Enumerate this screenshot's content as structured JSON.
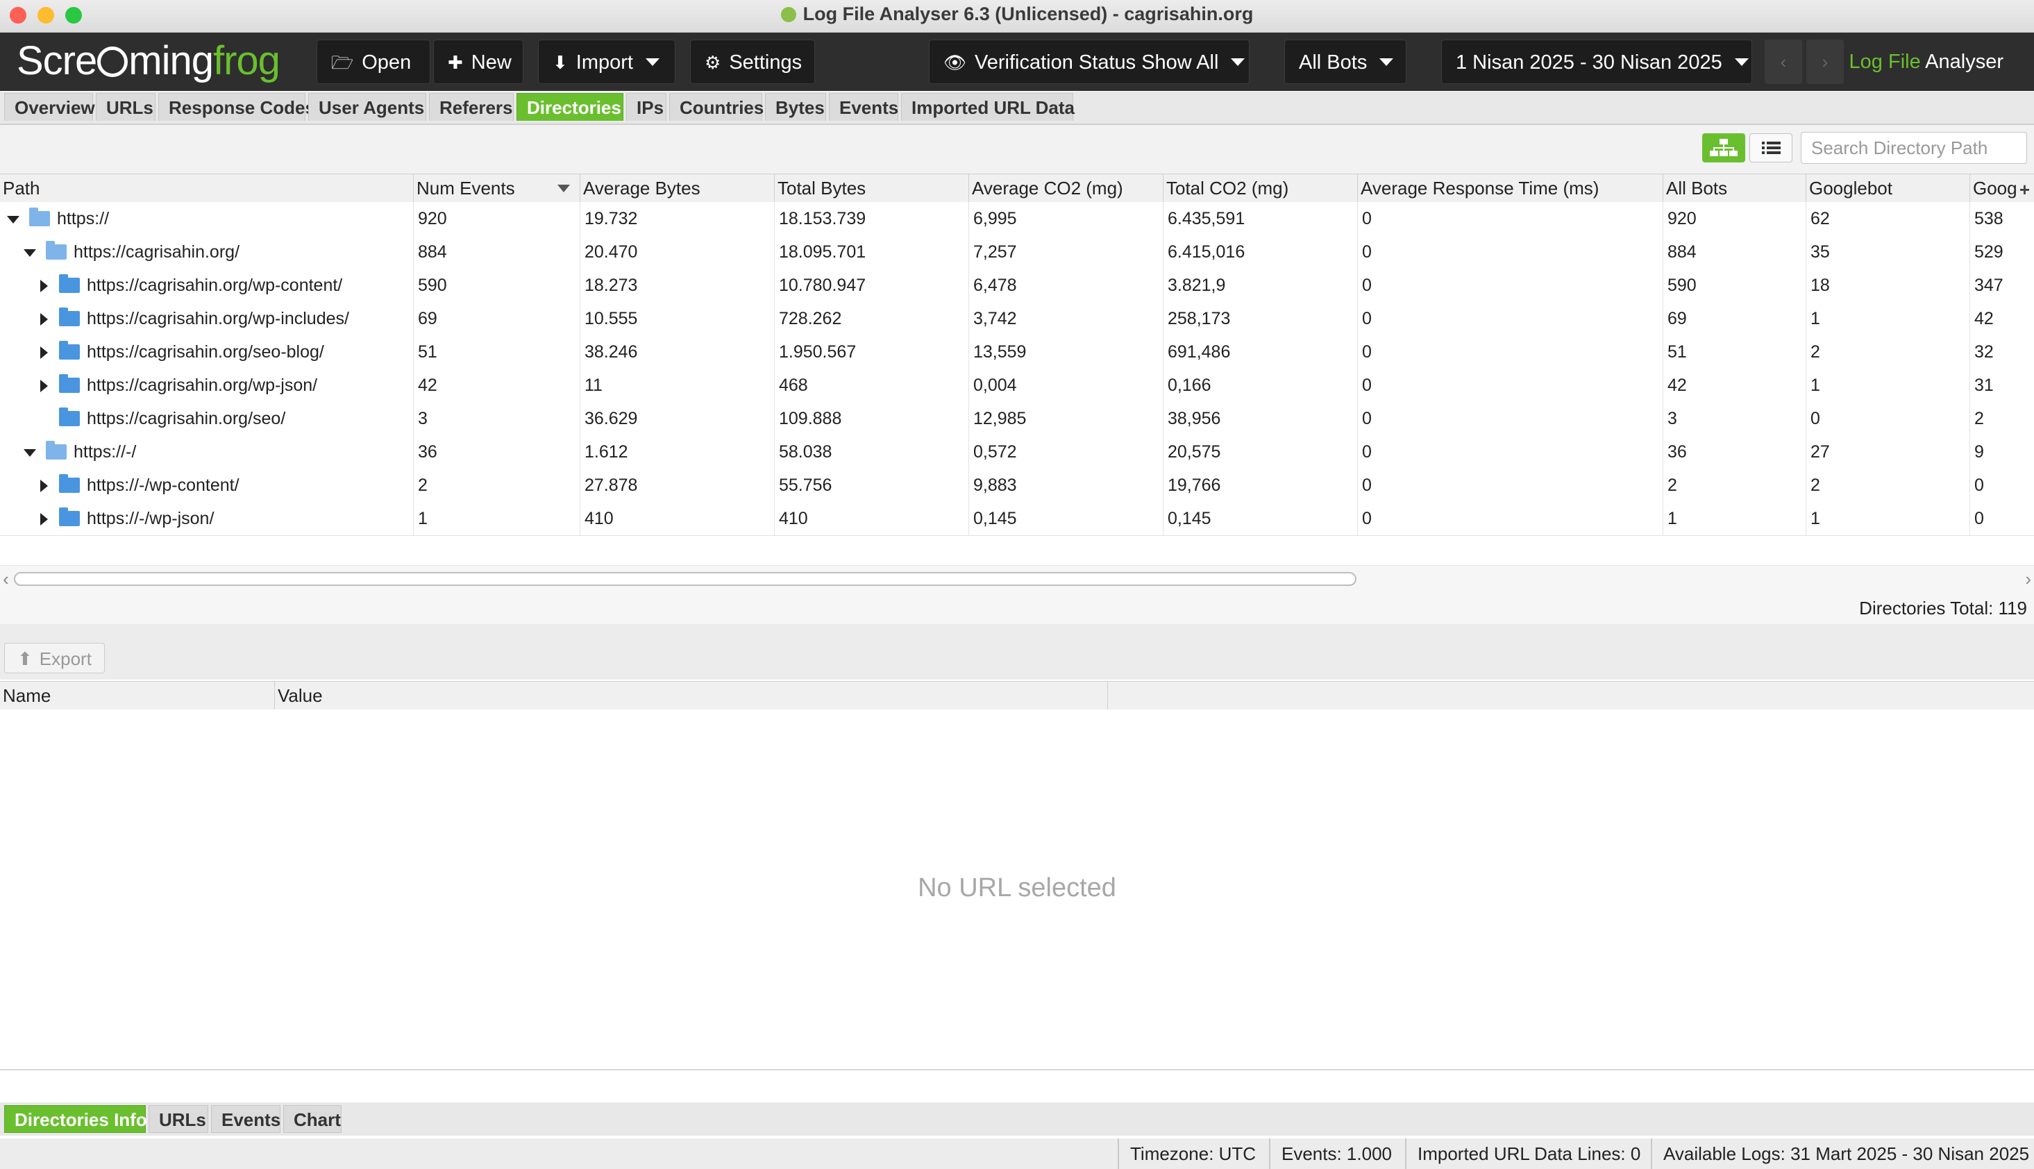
{
  "window": {
    "title": "Log File Analyser 6.3 (Unlicensed) - cagrisahin.org"
  },
  "toolbar": {
    "logo": {
      "part1": "Scre",
      "part2": "ming",
      "part3": "frog"
    },
    "open": "Open",
    "new": "New",
    "import": "Import",
    "settings": "Settings",
    "verification": "Verification Status Show All",
    "bots": "All Bots",
    "date_range": "1 Nisan 2025 - 30 Nisan 2025",
    "prev": "‹",
    "next": "›",
    "brand_green": "Log File",
    "brand_white": " Analyser"
  },
  "tabs": [
    "Overview",
    "URLs",
    "Response Codes",
    "User Agents",
    "Referers",
    "Directories",
    "IPs",
    "Countries",
    "Bytes",
    "Events",
    "Imported URL Data"
  ],
  "active_tab": "Directories",
  "search": {
    "placeholder": "Search Directory Path"
  },
  "grid": {
    "columns": [
      "Path",
      "Num Events",
      "Average Bytes",
      "Total Bytes",
      "Average CO2 (mg)",
      "Total CO2 (mg)",
      "Average Response Time (ms)",
      "All Bots",
      "Googlebot",
      "Goog"
    ],
    "rows": [
      [
        "https://",
        "920",
        "19.732",
        "18.153.739",
        "6,995",
        "6.435,591",
        "0",
        "920",
        "62",
        "538"
      ],
      [
        "https://cagrisahin.org/",
        "884",
        "20.470",
        "18.095.701",
        "7,257",
        "6.415,016",
        "0",
        "884",
        "35",
        "529"
      ],
      [
        "https://cagrisahin.org/wp-content/",
        "590",
        "18.273",
        "10.780.947",
        "6,478",
        "3.821,9",
        "0",
        "590",
        "18",
        "347"
      ],
      [
        "https://cagrisahin.org/wp-includes/",
        "69",
        "10.555",
        "728.262",
        "3,742",
        "258,173",
        "0",
        "69",
        "1",
        "42"
      ],
      [
        "https://cagrisahin.org/seo-blog/",
        "51",
        "38.246",
        "1.950.567",
        "13,559",
        "691,486",
        "0",
        "51",
        "2",
        "32"
      ],
      [
        "https://cagrisahin.org/wp-json/",
        "42",
        "11",
        "468",
        "0,004",
        "0,166",
        "0",
        "42",
        "1",
        "31"
      ],
      [
        "https://cagrisahin.org/seo/",
        "3",
        "36.629",
        "109.888",
        "12,985",
        "38,956",
        "0",
        "3",
        "0",
        "2"
      ],
      [
        "https://-/",
        "36",
        "1.612",
        "58.038",
        "0,572",
        "20,575",
        "0",
        "36",
        "27",
        "9"
      ],
      [
        "https://-/wp-content/",
        "2",
        "27.878",
        "55.756",
        "9,883",
        "19,766",
        "0",
        "2",
        "2",
        "0"
      ],
      [
        "https://-/wp-json/",
        "1",
        "410",
        "410",
        "0,145",
        "0,145",
        "0",
        "1",
        "1",
        "0"
      ]
    ]
  },
  "totals": "Directories Total: 119",
  "lower": {
    "export": "Export",
    "columns": [
      "Name",
      "Value"
    ],
    "empty": "No URL selected"
  },
  "bottom_tabs": [
    "Directories Info",
    "URLs",
    "Events",
    "Chart"
  ],
  "status": {
    "timezone": "Timezone:  UTC",
    "events": "Events:  1.000",
    "imported": "Imported URL Data Lines:  0",
    "available": "Available Logs:  31 Mart 2025 - 30 Nisan 2025"
  },
  "colors": {
    "accent": "#6abf2e",
    "toolbar_bg": "#2e2e2e",
    "folder": "#4a95e0"
  }
}
